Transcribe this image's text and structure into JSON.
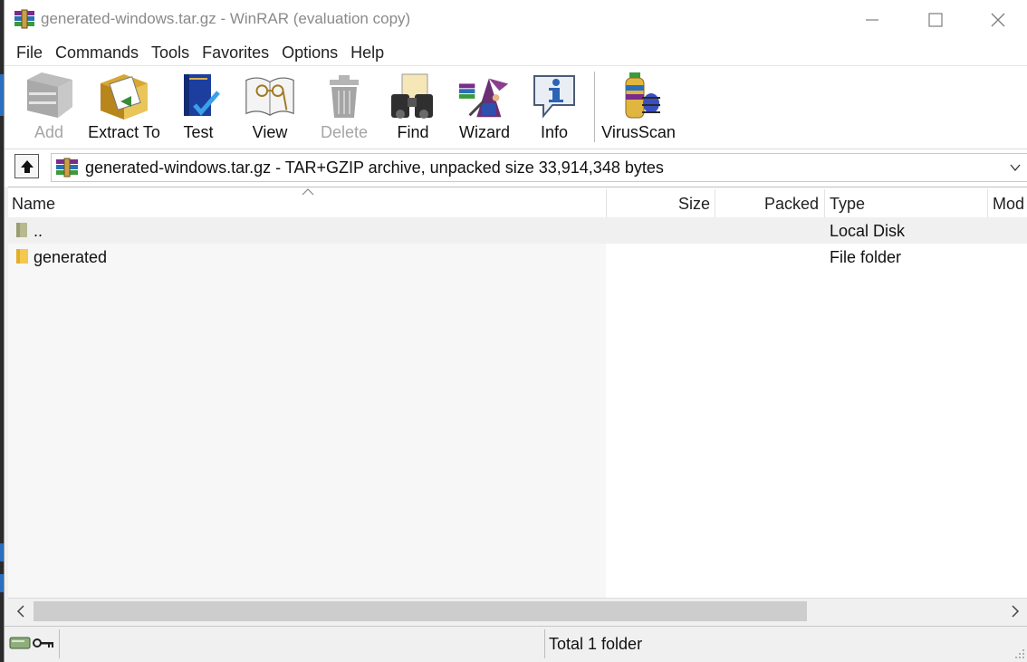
{
  "window": {
    "title": "generated-windows.tar.gz - WinRAR (evaluation copy)"
  },
  "menu": [
    "File",
    "Commands",
    "Tools",
    "Favorites",
    "Options",
    "Help"
  ],
  "toolbar": {
    "add": "Add",
    "extract_to": "Extract To",
    "test": "Test",
    "view": "View",
    "delete": "Delete",
    "find": "Find",
    "wizard": "Wizard",
    "info": "Info",
    "virusscan": "VirusScan"
  },
  "address": {
    "text": "generated-windows.tar.gz - TAR+GZIP archive, unpacked size 33,914,348 bytes"
  },
  "columns": {
    "name": "Name",
    "size": "Size",
    "packed": "Packed",
    "type": "Type",
    "modified": "Mod"
  },
  "rows": [
    {
      "name": "..",
      "type": "Local Disk"
    },
    {
      "name": "generated",
      "type": "File folder"
    }
  ],
  "status": {
    "text": "Total 1 folder"
  },
  "colors": {
    "selection": "#f0f0f0",
    "name_column_bg": "#f7f7f7",
    "folder": "#f4c94f"
  }
}
